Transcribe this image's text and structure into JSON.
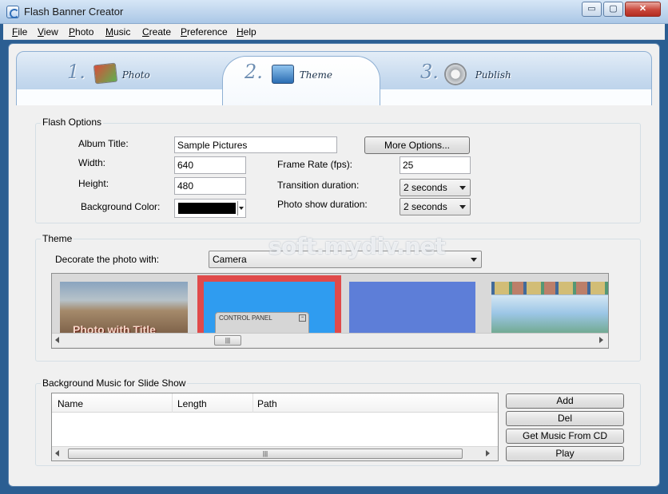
{
  "window": {
    "title": "Flash Banner Creator",
    "controls": {
      "minimize": "▭",
      "maximize": "▢",
      "close": "✕"
    }
  },
  "menu": [
    {
      "label": "File",
      "underline": "F",
      "rest": "ile"
    },
    {
      "label": "View",
      "underline": "V",
      "rest": "iew"
    },
    {
      "label": "Photo",
      "underline": "P",
      "rest": "hoto"
    },
    {
      "label": "Music",
      "underline": "M",
      "rest": "usic"
    },
    {
      "label": "Create",
      "underline": "C",
      "rest": "reate"
    },
    {
      "label": "Preference",
      "underline": "P",
      "rest": "reference"
    },
    {
      "label": "Help",
      "underline": "H",
      "rest": "elp"
    }
  ],
  "steps": [
    {
      "num": "1.",
      "label": "Photo",
      "icon": "photo-icon"
    },
    {
      "num": "2.",
      "label": "Theme",
      "icon": "theme-icon",
      "active": true
    },
    {
      "num": "3.",
      "label": "Publish",
      "icon": "gear-icon"
    }
  ],
  "flash_options": {
    "group_label": "Flash Options",
    "album_title_label": "Album Title:",
    "album_title_value": "Sample Pictures",
    "more_options_label": "More Options...",
    "width_label": "Width:",
    "width_value": "640",
    "height_label": "Height:",
    "height_value": "480",
    "frame_rate_label": "Frame Rate (fps):",
    "frame_rate_value": "25",
    "transition_label": "Transition duration:",
    "transition_value": "2 seconds",
    "photo_show_label": "Photo show duration:",
    "photo_show_value": "2 seconds",
    "bg_color_label": "Background Color:",
    "bg_color_value": "#000000"
  },
  "theme": {
    "group_label": "Theme",
    "decorate_label": "Decorate the photo with:",
    "decorate_value": "Camera",
    "thumb_title_text": "Photo with Title",
    "control_panel_text": "CONTROL PANEL",
    "selected_index": 1,
    "selected_border_color": "#e04a4a"
  },
  "music": {
    "group_label": "Background Music for Slide Show",
    "columns": [
      "Name",
      "Length",
      "Path"
    ],
    "rows": [],
    "buttons": {
      "add": "Add",
      "del": "Del",
      "get_cd": "Get Music From CD",
      "play": "Play"
    }
  },
  "watermark": "soft.mydiv.net"
}
